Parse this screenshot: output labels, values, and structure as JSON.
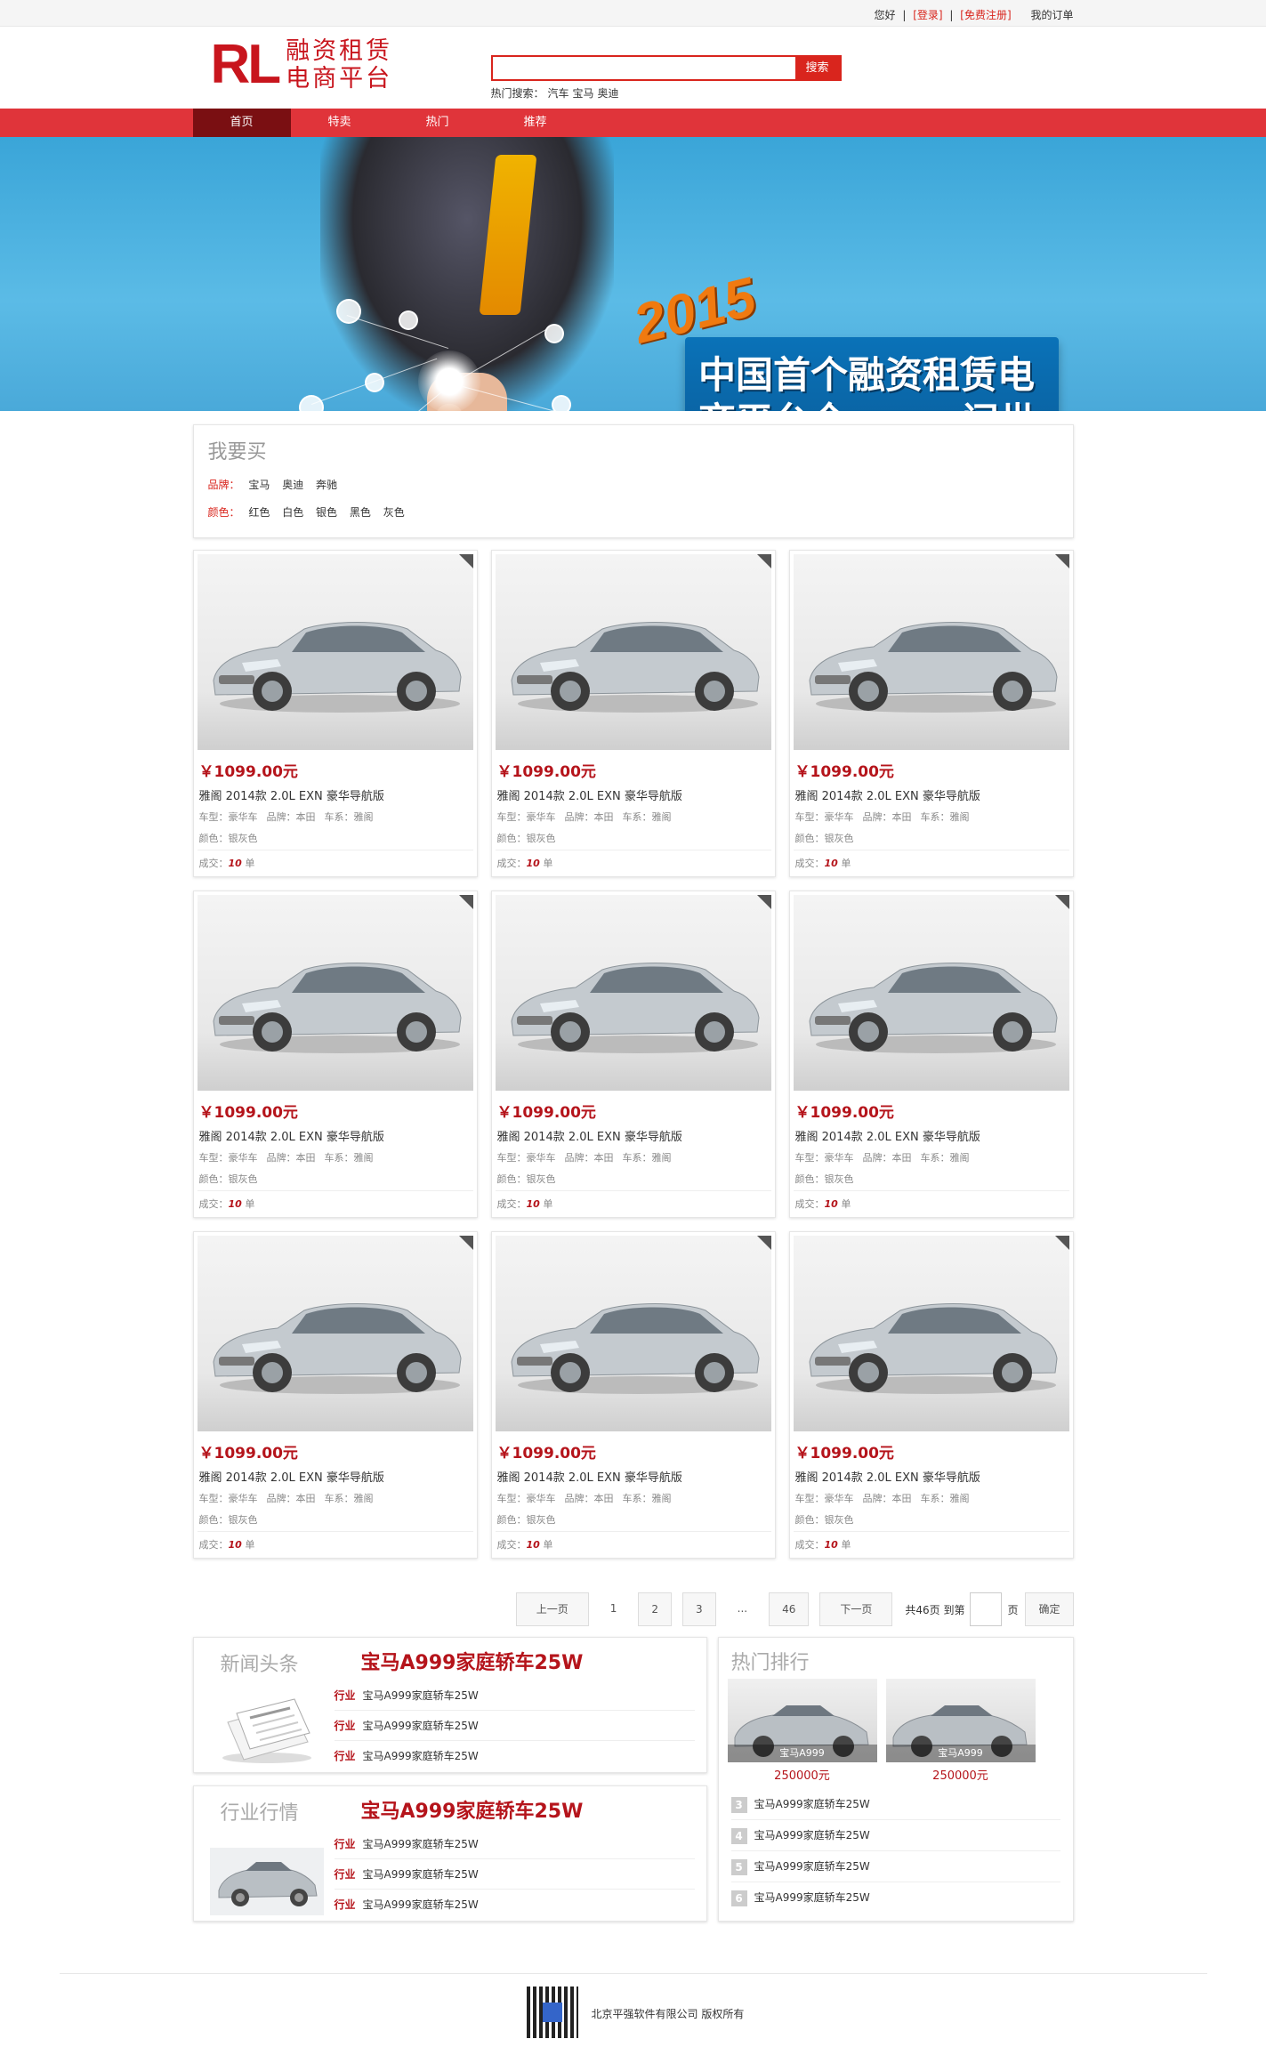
{
  "topbar": {
    "greeting": "您好",
    "login": "[登录]",
    "register": "[免费注册]",
    "orders": "我的订单",
    "sep": "|"
  },
  "logo": {
    "mark": "RL",
    "line1": "融资租赁",
    "line2": "电商平台"
  },
  "search": {
    "button": "搜索",
    "placeholder": "",
    "hot_label": "热门搜索：",
    "hot_terms": [
      "汽车",
      "宝马",
      "奥迪"
    ]
  },
  "nav": {
    "items": [
      "首页",
      "特卖",
      "热门",
      "推荐"
    ],
    "active": 0
  },
  "banner": {
    "year": "2015",
    "line1": "中国首个融资租赁电",
    "line2a": "商平台全",
    "xin": "新",
    "line2b": "问世"
  },
  "filter": {
    "title": "我要买",
    "brand_label": "品牌：",
    "brands": [
      "宝马",
      "奥迪",
      "奔驰"
    ],
    "color_label": "颜色：",
    "colors": [
      "红色",
      "白色",
      "银色",
      "黑色",
      "灰色"
    ]
  },
  "product": {
    "price": "￥1099.00元",
    "name": "雅阁 2014款 2.0L EXN 豪华导航版",
    "type": "车型：豪华车",
    "brand": "品牌：本田",
    "series": "车系：雅阁",
    "color": "颜色：银灰色",
    "deal_label": "成交：",
    "deal_count": "10",
    "deal_unit": "单"
  },
  "pager": {
    "prev": "上一页",
    "pages": [
      "1",
      "2",
      "3",
      "...",
      "46"
    ],
    "next": "下一页",
    "total": "共46页 到第",
    "unit": "页",
    "confirm": "确定"
  },
  "news_blocks": [
    {
      "title": "新闻头条",
      "headline": "宝马A999家庭轿车25W",
      "items": [
        {
          "tag": "行业",
          "text": "宝马A999家庭轿车25W"
        },
        {
          "tag": "行业",
          "text": "宝马A999家庭轿车25W"
        },
        {
          "tag": "行业",
          "text": "宝马A999家庭轿车25W"
        }
      ]
    },
    {
      "title": "行业行情",
      "headline": "宝马A999家庭轿车25W",
      "items": [
        {
          "tag": "行业",
          "text": "宝马A999家庭轿车25W"
        },
        {
          "tag": "行业",
          "text": "宝马A999家庭轿车25W"
        },
        {
          "tag": "行业",
          "text": "宝马A999家庭轿车25W"
        }
      ]
    }
  ],
  "hot": {
    "title": "热门排行",
    "products": [
      {
        "label": "宝马A999",
        "price": "250000元"
      },
      {
        "label": "宝马A999",
        "price": "250000元"
      }
    ],
    "list": [
      {
        "num": "3",
        "text": "宝马A999家庭轿车25W"
      },
      {
        "num": "4",
        "text": "宝马A999家庭轿车25W"
      },
      {
        "num": "5",
        "text": "宝马A999家庭轿车25W"
      },
      {
        "num": "6",
        "text": "宝马A999家庭轿车25W"
      }
    ]
  },
  "footer": {
    "copyright": "北京平强软件有限公司 版权所有"
  },
  "colors": {
    "brand_red": "#d9251d",
    "nav_red": "#e0343a",
    "price_red": "#b5141b",
    "nav_active": "#7a0f12"
  }
}
